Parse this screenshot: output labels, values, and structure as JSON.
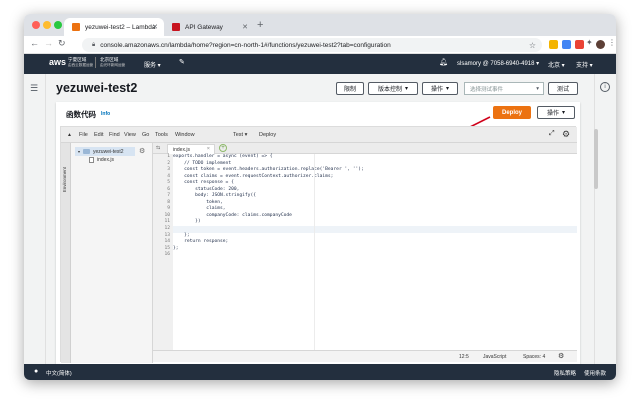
{
  "browser": {
    "tabs": [
      {
        "title": "yezuwei-test2 – Lambda",
        "favicon_color": "#ec7211"
      },
      {
        "title": "API Gateway",
        "favicon_color": "#c7131f"
      }
    ],
    "url": "console.amazonaws.cn/lambda/home?region=cn-north-1#/functions/yezuwei-test2?tab=configuration",
    "traffic_colors": [
      "#ff5f57",
      "#febc2e",
      "#28c840"
    ]
  },
  "aws_header": {
    "logo": "aws",
    "region_line1": "宁夏区域",
    "region_line1_sub": "由西云数据运营",
    "region_line2": "北京区域",
    "region_line2_sub": "由光环新网运营",
    "services": "服务",
    "account": "slsamory @ 7058-6940-4918",
    "region": "北京",
    "support": "支持"
  },
  "page": {
    "title": "yezuwei-test2",
    "buttons": {
      "throttle": "限制",
      "version": "版本控制",
      "actions": "操作",
      "test": "测试"
    },
    "test_event_placeholder": "选择测试事件"
  },
  "panel": {
    "title": "函数代码",
    "info": "Info",
    "deploy": "Deploy",
    "actions": "操作"
  },
  "ide": {
    "menu": [
      "File",
      "Edit",
      "Find",
      "View",
      "Go",
      "Tools",
      "Window",
      "Test",
      "Deploy"
    ],
    "environment_label": "Environment",
    "folder": "yezuwei-test2",
    "file": "index.js",
    "editor_tab": "index.js",
    "line_numbers": [
      "1",
      "2",
      "3",
      "4",
      "5",
      "6",
      "7",
      "8",
      "9",
      "10",
      "11",
      "12",
      "13",
      "14",
      "15",
      "16"
    ],
    "code_lines": [
      "exports.handler = async (event) => {",
      "    // TODO implement",
      "    const token = event.headers.authorization.replace('Bearer ', '');",
      "    const claims = event.requestContext.authorizer.claims;",
      "    const response = {",
      "        statusCode: 200,",
      "        body: JSON.stringify({",
      "            token,",
      "            claims,",
      "            companyCode: claims.companyCode",
      "        })",
      "    ",
      "    };",
      "    return response;",
      "};",
      ""
    ],
    "status": {
      "cursor": "12:5",
      "language": "JavaScript",
      "spaces": "Spaces: 4"
    }
  },
  "footer": {
    "language": "中文(简体)",
    "privacy": "隐私策略",
    "terms": "使用条款"
  }
}
